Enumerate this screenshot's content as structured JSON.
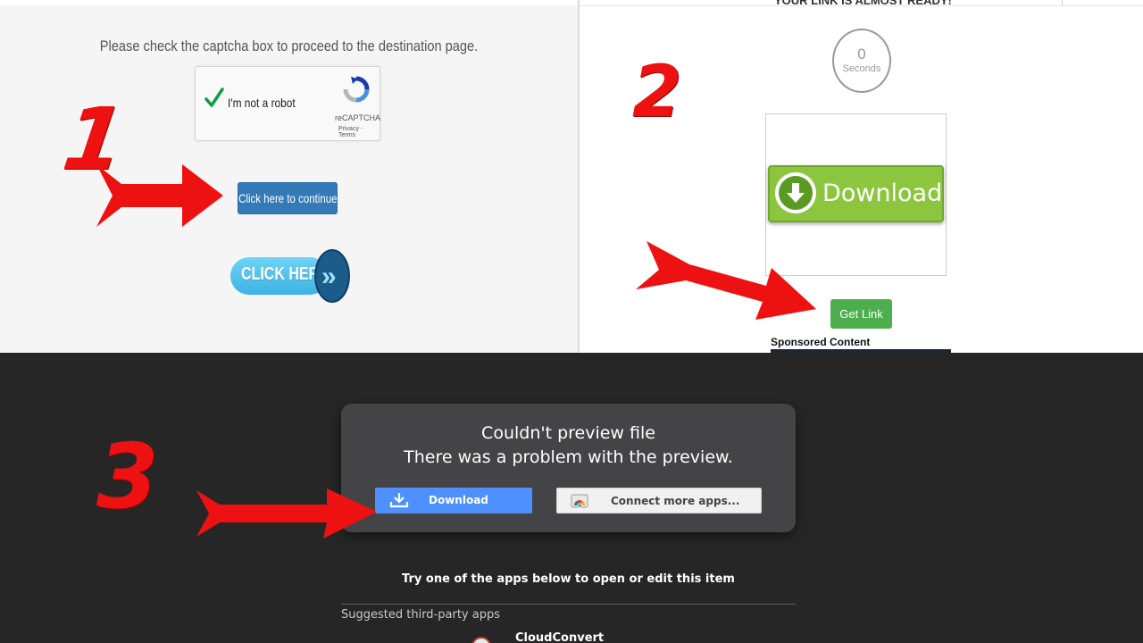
{
  "panel1": {
    "notice": "Please check the captcha box to proceed to the destination page.",
    "captcha": {
      "label": "I'm not a robot",
      "brand": "reCAPTCHA",
      "terms": "Privacy - Terms",
      "checked": true
    },
    "continue_button": "Click here to continue",
    "click_here_label": "CLICK HERE",
    "click_here_chevron": "»"
  },
  "panel2": {
    "heading": "YOUR LINK IS ALMOST READY!",
    "timer_value": "0",
    "timer_unit": "Seconds",
    "download_banner": "Download",
    "get_link_button": "Get Link",
    "sponsored": "Sponsored Content"
  },
  "panel3": {
    "title": "Couldn't preview file",
    "subtitle": "There was a problem with the preview.",
    "download_button": "Download",
    "connect_button": "Connect more apps...",
    "try_text": "Try one of the apps below to open or edit this item",
    "suggested_label": "Suggested third-party apps",
    "app_name": "CloudConvert"
  },
  "steps": [
    "1",
    "2",
    "3"
  ],
  "colors": {
    "annotation_red": "#ee1111",
    "bootstrap_blue": "#337ab7",
    "get_link_green": "#4cae4c",
    "drive_blue": "#4d90fe",
    "download_banner_green": "#8cc63e",
    "drive_dark_bg": "#262626"
  },
  "icons": [
    "checkmark-icon",
    "recaptcha-logo-icon",
    "chevron-double-right-icon",
    "download-arrow-icon",
    "drive-download-icon",
    "chrome-webstore-icon",
    "cloudconvert-icon",
    "red-arrow-icon"
  ]
}
